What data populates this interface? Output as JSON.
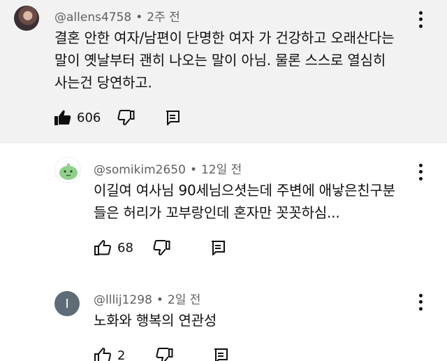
{
  "comments": [
    {
      "handle": "@allens4758",
      "time": "2주 전",
      "text": "결혼 안한 여자/남편이 단명한 여자 가 건강하고 오래산다는\n말이 옛날부터 괜히 나오는 말이 아님. 물론 스스로 열심히\n사는건 당연하고.",
      "likes": "606",
      "liked": true
    },
    {
      "handle": "@somikim2650",
      "time": "12일 전",
      "text": "이길여 여사님 90세님으셧는데 주변에 애낳은친구분\n들은 허리가 꼬부랑인데 혼자만 꼿꼿하심...",
      "likes": "68",
      "liked": false
    },
    {
      "handle": "@lllij1298",
      "time": "2일 전",
      "avatar_letter": "I",
      "text": "노화와 행복의 연관성",
      "likes": "2",
      "liked": false
    }
  ],
  "separator": "•",
  "icons": {
    "like": "thumbs-up-icon",
    "dislike": "thumbs-down-icon",
    "reply": "reply-comment-icon",
    "more": "more-vert-icon"
  },
  "colors": {
    "highlight_background": "#f2f2f2",
    "meta_text": "#606060",
    "text": "#0f0f0f",
    "avatar_letter_bg": "#5f6b76",
    "avatar_green": "#8fd18a"
  }
}
